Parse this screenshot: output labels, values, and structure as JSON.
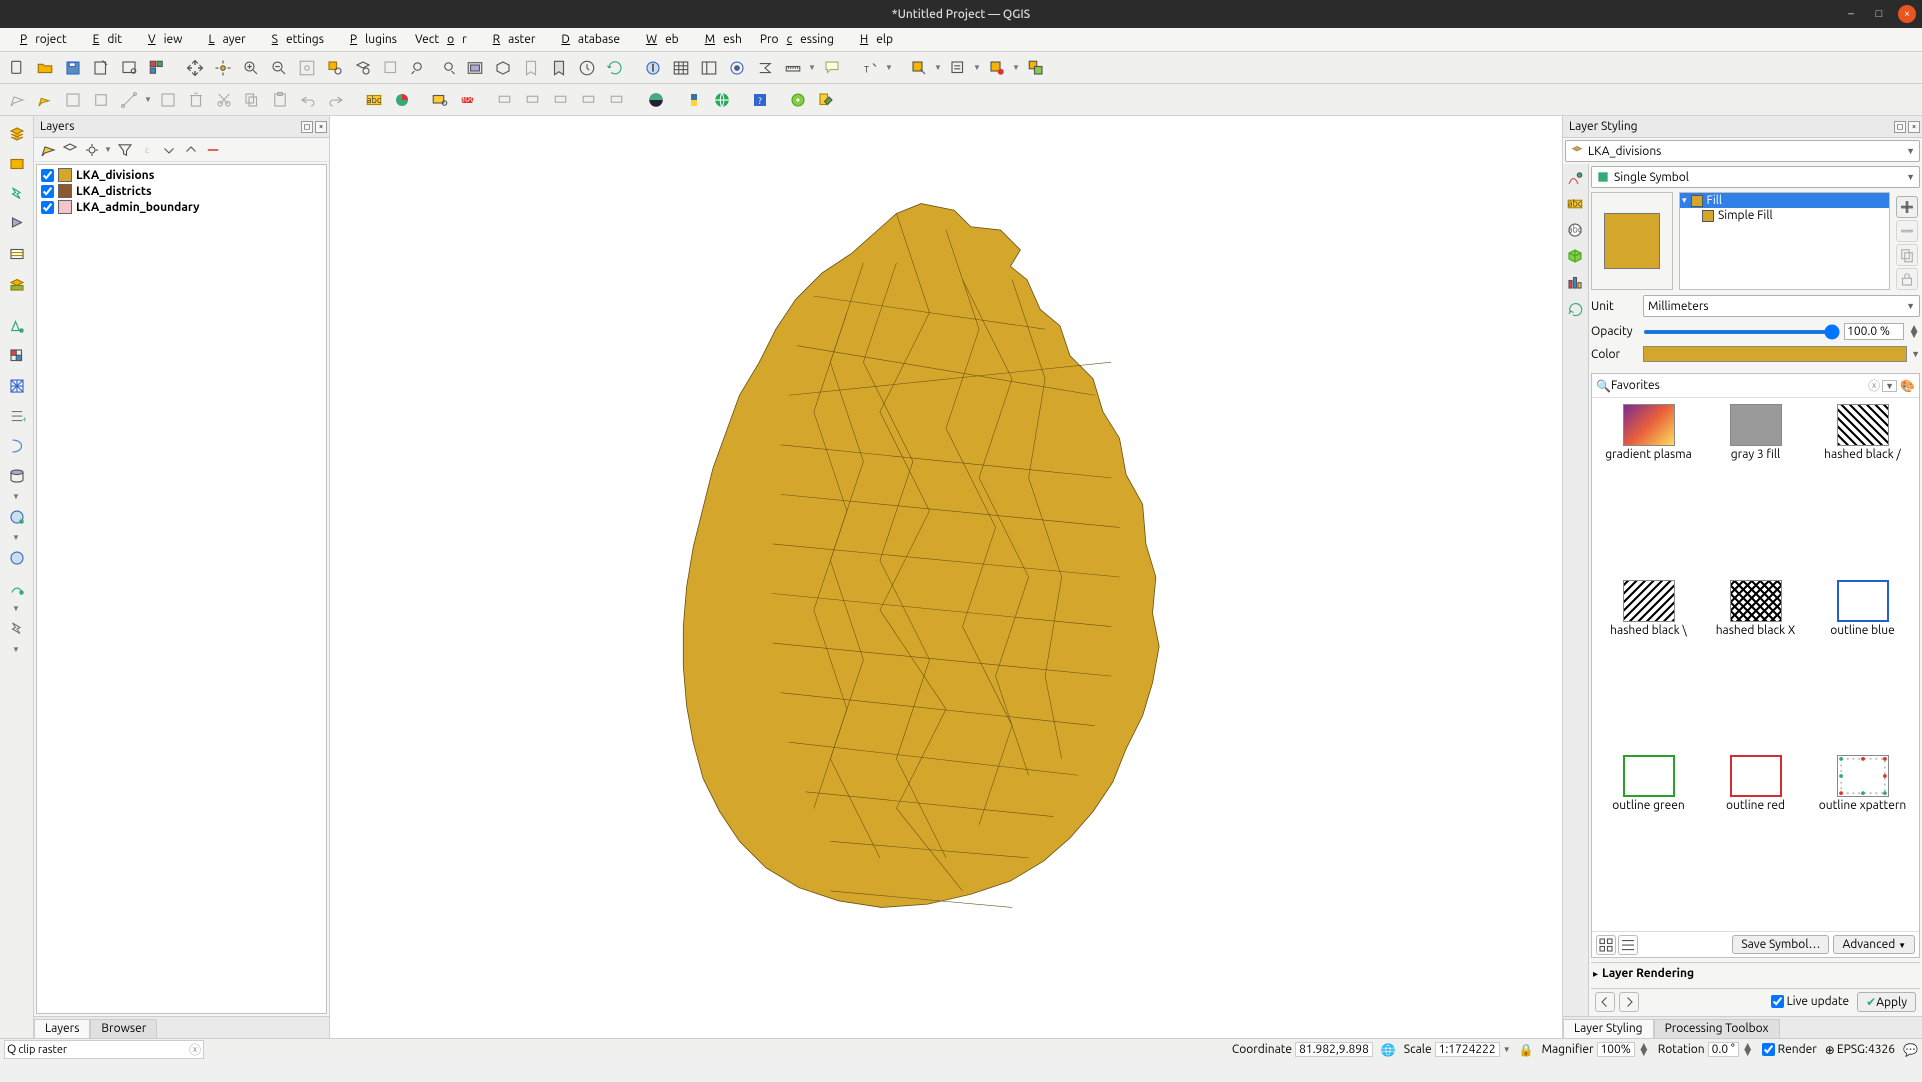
{
  "titlebar": {
    "title": "*Untitled Project — QGIS"
  },
  "menu": {
    "project": "Project",
    "edit": "Edit",
    "view": "View",
    "layer": "Layer",
    "settings": "Settings",
    "plugins": "Plugins",
    "vector": "Vector",
    "raster": "Raster",
    "database": "Database",
    "web": "Web",
    "mesh": "Mesh",
    "processing": "Processing",
    "help": "Help"
  },
  "layers_panel": {
    "title": "Layers",
    "items": [
      {
        "label": "LKA_divisions",
        "color": "#d4a72c",
        "checked": true
      },
      {
        "label": "LKA_districts",
        "color": "#8a5a2e",
        "checked": true
      },
      {
        "label": "LKA_admin_boundary",
        "color": "#f3c4c9",
        "checked": true
      }
    ],
    "tabs": {
      "layers": "Layers",
      "browser": "Browser"
    }
  },
  "styling": {
    "title": "Layer Styling",
    "layer_combo": "LKA_divisions",
    "renderer": "Single Symbol",
    "tree": {
      "fill": "Fill",
      "simple_fill": "Simple Fill"
    },
    "unit_label": "Unit",
    "unit_value": "Millimeters",
    "opacity_label": "Opacity",
    "opacity_value": "100.0 %",
    "color_label": "Color",
    "fav_label": "Favorites",
    "favorites": [
      "gradient plasma",
      "gray 3 fill",
      "hashed black /",
      "hashed black \\",
      "hashed black X",
      "outline blue",
      "outline green",
      "outline red",
      "outline xpattern"
    ],
    "save_symbol": "Save Symbol…",
    "advanced": "Advanced",
    "layer_rendering": "Layer Rendering",
    "live_update": "Live update",
    "apply": "Apply",
    "tabs": {
      "ls": "Layer Styling",
      "pt": "Processing Toolbox"
    }
  },
  "statusbar": {
    "search_value": "clip raster",
    "coord_label": "Coordinate",
    "coord_value": "81.982,9.898",
    "scale_label": "Scale",
    "scale_value": "1:1724222",
    "magnifier_label": "Magnifier",
    "magnifier_value": "100%",
    "rotation_label": "Rotation",
    "rotation_value": "0.0 °",
    "render_label": "Render",
    "crs": "EPSG:4326"
  },
  "colors": {
    "map_fill": "#d4a72c",
    "map_stroke": "#6b5214"
  }
}
